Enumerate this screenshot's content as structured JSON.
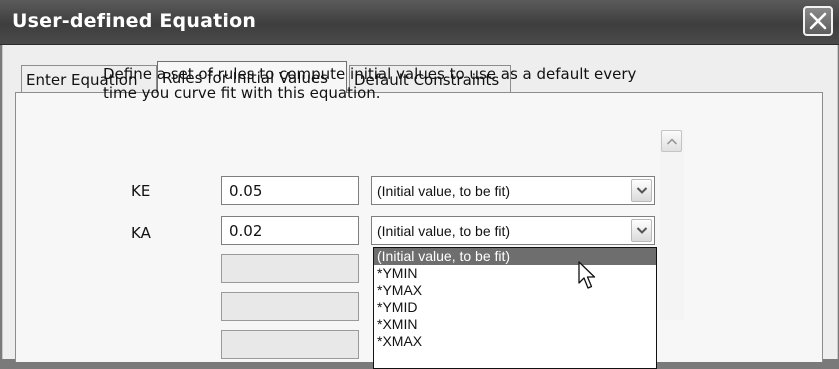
{
  "window": {
    "title": "User-defined Equation",
    "close_icon": "close-x-icon"
  },
  "tabs": [
    {
      "label": "Enter Equation",
      "active": false
    },
    {
      "label": "Rules for Initial Values",
      "active": true
    },
    {
      "label": "Default Constraints",
      "active": false
    }
  ],
  "panel": {
    "description": "Define a set of rules to compute initial values to use as a default every time you curve fit with this equation."
  },
  "params": [
    {
      "name": "KE",
      "value": "0.05",
      "rule": "(Initial value, to be fit)"
    },
    {
      "name": "KA",
      "value": "0.02",
      "rule": "(Initial value, to be fit)"
    }
  ],
  "dropdown": {
    "options": [
      "(Initial value, to be fit)",
      "*YMIN",
      "*YMAX",
      "*YMID",
      "*XMIN",
      "*XMAX"
    ],
    "highlighted_index": 0
  },
  "colors": {
    "titlebar": "#4a4a4a",
    "selection": "#6e6e6e",
    "panel": "#f7f7f7"
  }
}
